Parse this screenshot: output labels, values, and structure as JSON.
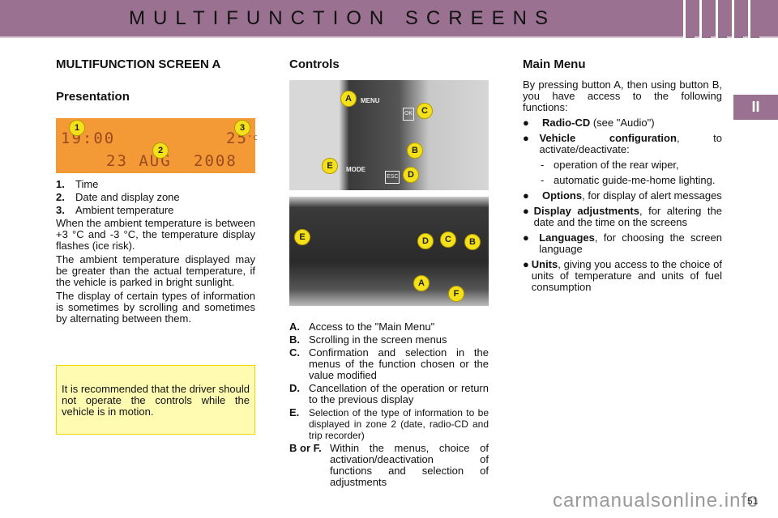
{
  "header": {
    "title": "MULTIFUNCTION SCREENS",
    "section_tab": "II"
  },
  "col1": {
    "heading": "MULTIFUNCTION SCREEN A",
    "subheading": "Presentation",
    "display": {
      "time": "19:00",
      "temp": "25",
      "unit": "°C",
      "date": "23 AUG",
      "year": "2008",
      "badges": [
        "1",
        "2",
        "3"
      ]
    },
    "items": [
      {
        "n": "1.",
        "t": "Time"
      },
      {
        "n": "2.",
        "t": "Date and display zone"
      },
      {
        "n": "3.",
        "t": "Ambient temperature"
      }
    ],
    "paragraphs": [
      "When the ambient temperature is between +3 °C and -3 °C, the temperature display flashes (ice risk).",
      "The ambient temperature displayed may be greater than the actual temperature, if the vehicle is parked in bright sunlight.",
      "The display of certain types of information is sometimes by scrolling and sometimes by alternating between them."
    ],
    "note": "It is recommended that the driver should not operate the controls while the vehicle is in motion."
  },
  "col2": {
    "heading": "Controls",
    "photo1_labels": [
      "A",
      "MENU",
      "C",
      "OK",
      "B",
      "E",
      "MODE",
      "D",
      "ESC"
    ],
    "photo2_labels": [
      "E",
      "D",
      "C",
      "B",
      "A",
      "F"
    ],
    "items": [
      {
        "n": "A.",
        "t": "Access to the \"Main Menu\""
      },
      {
        "n": "B.",
        "t": "Scrolling in the screen menus"
      },
      {
        "n": "C.",
        "t": "Confirmation and selection in the menus of the function chosen or the value modified"
      },
      {
        "n": "D.",
        "t": "Cancellation of the operation or return to the previous display"
      },
      {
        "n": "E.",
        "t": "Selection of the type of information to be displayed in zone 2 (date, radio-CD and trip recorder)"
      },
      {
        "n": "B or F.",
        "t": "Within the menus, choice of activation/deactivation of functions and selection of adjustments"
      }
    ]
  },
  "col3": {
    "heading": "Main Menu",
    "intro": "By pressing button A, then using button B, you have access to the following functions:",
    "bullets": [
      {
        "b": "Radio-CD",
        "t": " (see \"Audio\")"
      },
      {
        "b": "Vehicle configuration",
        "t": ", to activate/deactivate:"
      },
      {
        "b": "Options",
        "t": ", for display of alert messages"
      },
      {
        "b": "Display adjustments",
        "t": ", for altering the date and the time on the screens"
      },
      {
        "b": "Languages",
        "t": ", for choosing the screen language"
      },
      {
        "b": "Units",
        "t": ", giving you access to the choice of units of temperature and units of fuel consumption"
      }
    ],
    "sub_items": [
      "operation of the rear wiper,",
      "automatic guide-me-home lighting."
    ]
  },
  "footer": {
    "page": "51",
    "watermark": "carmanualsonline.info"
  },
  "colors": {
    "header": "#9a7190",
    "display": "#f39a36",
    "note": "#fffbb0",
    "badge": "#f4e11c"
  }
}
